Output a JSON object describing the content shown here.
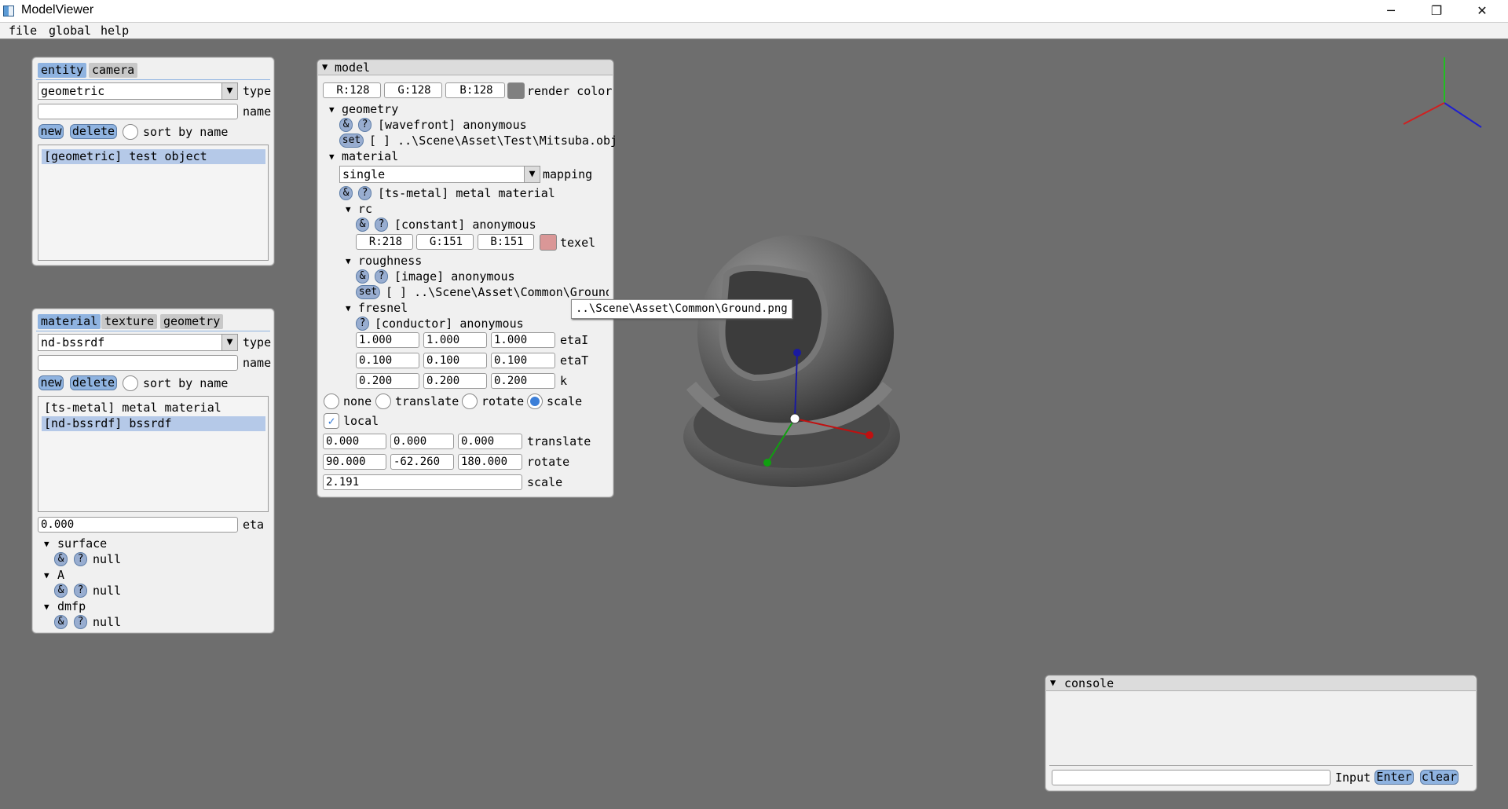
{
  "window": {
    "title": "ModelViewer",
    "minimize": "─",
    "maximize": "❐",
    "close": "✕"
  },
  "menu": [
    "file",
    "global",
    "help"
  ],
  "entity_panel": {
    "tabs": [
      "entity",
      "camera"
    ],
    "type_value": "geometric",
    "type_label": "type",
    "name_value": "",
    "name_label": "name",
    "new_label": "new",
    "delete_label": "delete",
    "sort_label": "sort by name",
    "items": [
      "[geometric] test object"
    ]
  },
  "material_panel": {
    "tabs": [
      "material",
      "texture",
      "geometry"
    ],
    "type_value": "nd-bssrdf",
    "type_label": "type",
    "name_value": "",
    "name_label": "name",
    "new_label": "new",
    "delete_label": "delete",
    "sort_label": "sort by name",
    "items": [
      "[ts-metal] metal material",
      "[nd-bssrdf] bssrdf"
    ],
    "eta_value": "0.000",
    "eta_label": "eta",
    "sections": [
      {
        "name": "surface",
        "value": "null"
      },
      {
        "name": "A",
        "value": "null"
      },
      {
        "name": "dmfp",
        "value": "null"
      }
    ]
  },
  "model_panel": {
    "title": "model",
    "render_color": {
      "r": "R:128",
      "g": "G:128",
      "b": "B:128",
      "label": "render color",
      "swatch": "#808080"
    },
    "geometry": {
      "header": "geometry",
      "desc": "[wavefront] anonymous",
      "set": "set",
      "path": "[ ] ..\\Scene\\Asset\\Test\\Mitsuba.obj"
    },
    "material": {
      "header": "material",
      "mapping_value": "single",
      "mapping_label": "mapping",
      "desc": "[ts-metal] metal material"
    },
    "rc": {
      "header": "rc",
      "desc": "[constant] anonymous",
      "r": "R:218",
      "g": "G:151",
      "b": "B:151",
      "label": "texel",
      "swatch": "#da9797"
    },
    "roughness": {
      "header": "roughness",
      "desc": "[image] anonymous",
      "set": "set",
      "path": "[ ] ..\\Scene\\Asset\\Common\\Ground."
    },
    "fresnel": {
      "header": "fresnel",
      "desc": "[conductor] anonymous",
      "rows": [
        {
          "values": [
            "1.000",
            "1.000",
            "1.000"
          ],
          "label": "etaI"
        },
        {
          "values": [
            "0.100",
            "0.100",
            "0.100"
          ],
          "label": "etaT"
        },
        {
          "values": [
            "0.200",
            "0.200",
            "0.200"
          ],
          "label": "k"
        }
      ]
    },
    "transform_modes": [
      "none",
      "translate",
      "rotate",
      "scale"
    ],
    "local_label": "local",
    "translate": {
      "values": [
        "0.000",
        "0.000",
        "0.000"
      ],
      "label": "translate"
    },
    "rotate": {
      "values": [
        "90.000",
        "-62.260",
        "180.000"
      ],
      "label": "rotate"
    },
    "scale": {
      "value": "2.191",
      "label": "scale"
    }
  },
  "tooltip": "..\\Scene\\Asset\\Common\\Ground.png",
  "console": {
    "title": "console",
    "input_label": "Input",
    "enter_label": "Enter",
    "clear_label": "clear"
  },
  "icons": {
    "amp": "&",
    "question": "?",
    "check": "✓",
    "arrow_down": "▼",
    "tri_down": "▼"
  }
}
